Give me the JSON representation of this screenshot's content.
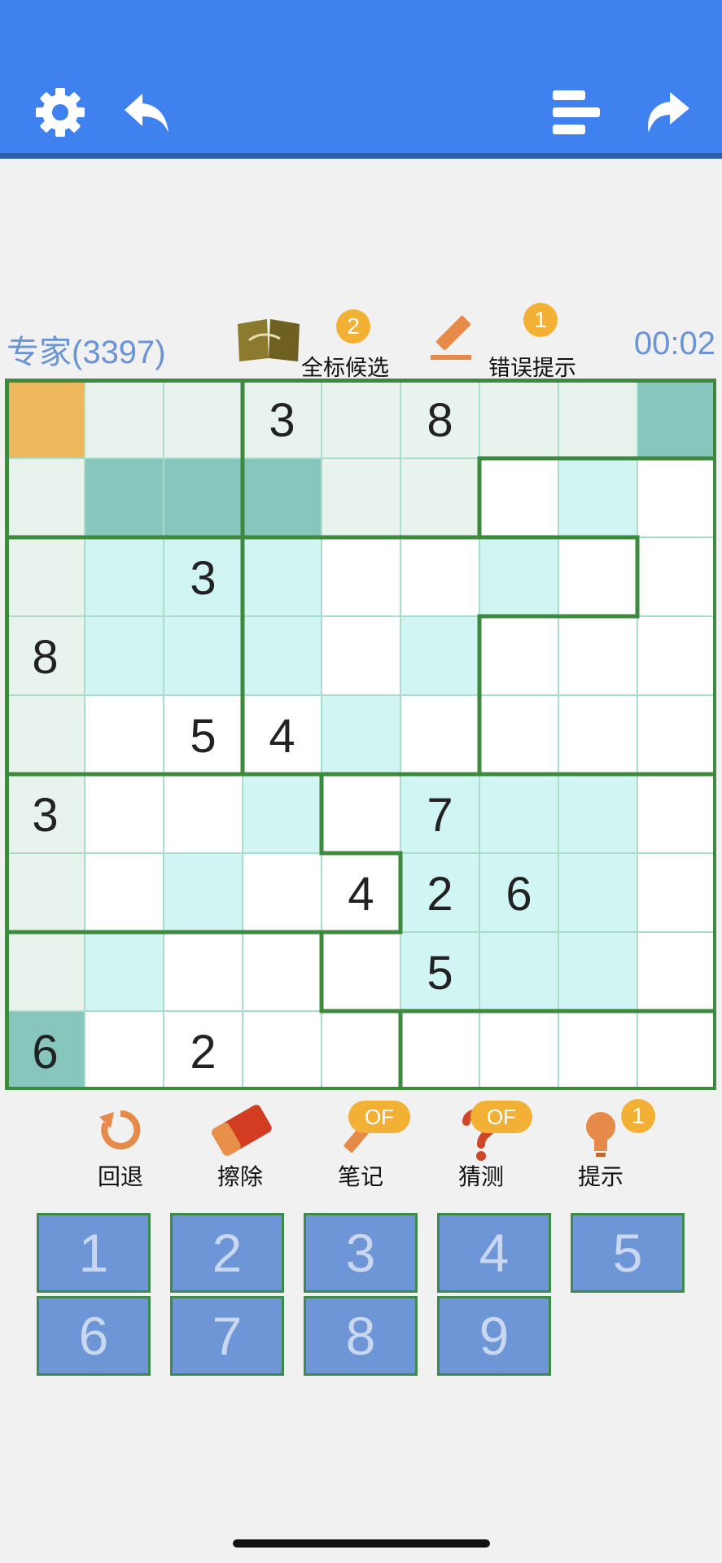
{
  "level": "专家(3397)",
  "timer": "00:02",
  "top_tools": {
    "mark_all_label": "全标候选",
    "mark_all_badge": "2",
    "error_hint_label": "错误提示",
    "error_hint_badge": "1"
  },
  "board": {
    "givens": [
      [
        null,
        null,
        null,
        "3",
        null,
        "8",
        null,
        null,
        null
      ],
      [
        null,
        null,
        null,
        null,
        null,
        null,
        null,
        null,
        null
      ],
      [
        null,
        null,
        "3",
        null,
        null,
        null,
        null,
        null,
        null
      ],
      [
        "8",
        null,
        null,
        null,
        null,
        null,
        null,
        null,
        null
      ],
      [
        null,
        null,
        "5",
        "4",
        null,
        null,
        null,
        null,
        null
      ],
      [
        "3",
        null,
        null,
        null,
        null,
        "7",
        null,
        null,
        null
      ],
      [
        null,
        null,
        null,
        null,
        "4",
        "2",
        "6",
        null,
        null
      ],
      [
        null,
        null,
        null,
        null,
        null,
        "5",
        null,
        null,
        null
      ],
      [
        "6",
        null,
        "2",
        null,
        null,
        null,
        null,
        null,
        null
      ]
    ],
    "regions": [
      [
        0,
        0,
        0,
        1,
        1,
        1,
        1,
        1,
        1
      ],
      [
        0,
        0,
        0,
        1,
        1,
        1,
        2,
        2,
        2
      ],
      [
        3,
        3,
        3,
        4,
        4,
        4,
        4,
        4,
        2
      ],
      [
        3,
        3,
        3,
        4,
        4,
        4,
        2,
        2,
        2
      ],
      [
        3,
        3,
        3,
        4,
        4,
        4,
        2,
        2,
        2
      ],
      [
        5,
        5,
        5,
        5,
        6,
        6,
        6,
        6,
        6
      ],
      [
        5,
        5,
        5,
        5,
        5,
        6,
        6,
        6,
        6
      ],
      [
        7,
        7,
        7,
        7,
        6,
        6,
        6,
        6,
        6
      ],
      [
        7,
        7,
        7,
        7,
        7,
        8,
        8,
        8,
        8
      ]
    ],
    "shading": [
      [
        "sel",
        "r",
        "r",
        "r",
        "r",
        "r",
        "r",
        "r",
        "d"
      ],
      [
        "r",
        "d",
        "d",
        "d",
        "r",
        "r",
        "w",
        "c",
        "w"
      ],
      [
        "r",
        "c",
        "c",
        "c",
        "w",
        "w",
        "c",
        "w",
        "w"
      ],
      [
        "r",
        "c",
        "c",
        "c",
        "w",
        "c",
        "w",
        "w",
        "w"
      ],
      [
        "r",
        "w",
        "w",
        "w",
        "c",
        "w",
        "w",
        "w",
        "w"
      ],
      [
        "r",
        "w",
        "w",
        "c",
        "w",
        "c",
        "c",
        "c",
        "w"
      ],
      [
        "r",
        "w",
        "c",
        "w",
        "w",
        "c",
        "c",
        "c",
        "w"
      ],
      [
        "r",
        "c",
        "w",
        "w",
        "w",
        "c",
        "c",
        "c",
        "w"
      ],
      [
        "d",
        "w",
        "w",
        "w",
        "w",
        "w",
        "w",
        "w",
        "w"
      ]
    ],
    "colors": {
      "sel": "#edb85c",
      "r": "#e9f3ee",
      "d": "#87c6bd",
      "c": "#d1f5f3",
      "w": "#ffffff"
    }
  },
  "tools": [
    {
      "label": "回退",
      "icon": "undo-icon"
    },
    {
      "label": "擦除",
      "icon": "eraser-icon"
    },
    {
      "label": "笔记",
      "icon": "pencil-icon",
      "pill": "OF"
    },
    {
      "label": "猜测",
      "icon": "question-icon",
      "pill": "OF"
    },
    {
      "label": "提示",
      "icon": "lightbulb-icon",
      "badge": "1"
    }
  ],
  "keypad": [
    "1",
    "2",
    "3",
    "4",
    "5",
    "6",
    "7",
    "8",
    "9"
  ]
}
